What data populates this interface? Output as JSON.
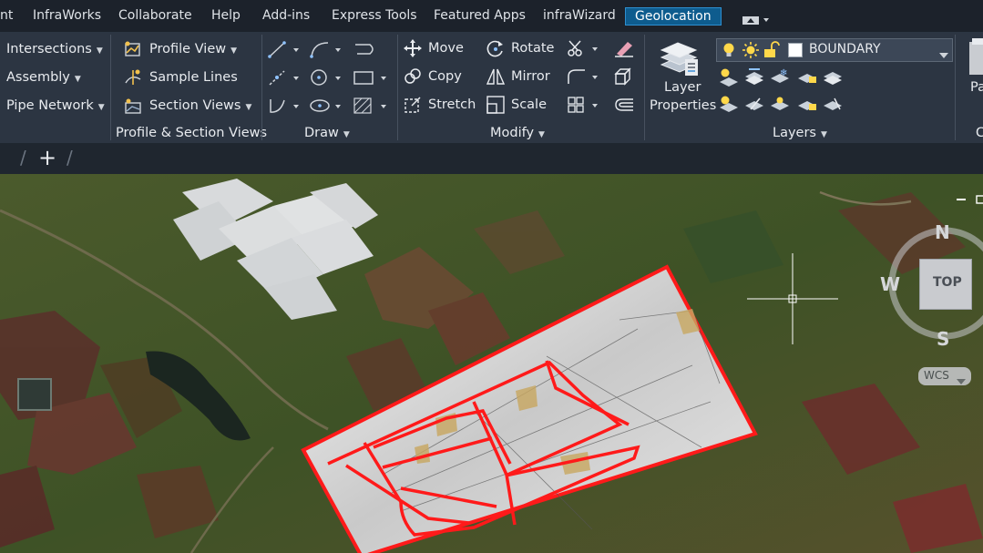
{
  "menubar": {
    "items": [
      "nt",
      "InfraWorks",
      "Collaborate",
      "Help",
      "Add-ins",
      "Express Tools",
      "Featured Apps",
      "infraWizard",
      "Geolocation"
    ],
    "active": "Geolocation"
  },
  "ribbon": {
    "col1": [
      "Intersections",
      "Assembly",
      "Pipe Network"
    ],
    "col2": [
      "Profile View",
      "Sample Lines",
      "Section Views"
    ],
    "profile_section_title": "Profile & Section Views",
    "draw_title": "Draw",
    "modify": {
      "move": "Move",
      "rotate": "Rotate",
      "copy": "Copy",
      "mirror": "Mirror",
      "stretch": "Stretch",
      "scale": "Scale"
    },
    "modify_title": "Modify",
    "layer_properties_1": "Layer",
    "layer_properties_2": "Properties",
    "layer_name": "BOUNDARY",
    "layers_title": "Layers",
    "paste_partial": "Pa",
    "clip_partial": "C"
  },
  "tabstrip": {
    "plus": "+"
  },
  "viewcube": {
    "n": "N",
    "s": "S",
    "w": "W",
    "top": "TOP",
    "wcs": "WCS"
  },
  "colors": {
    "accent": "#0e5c8e",
    "boundary": "#ff1a1a",
    "ribbon_bg": "#2c3542"
  }
}
